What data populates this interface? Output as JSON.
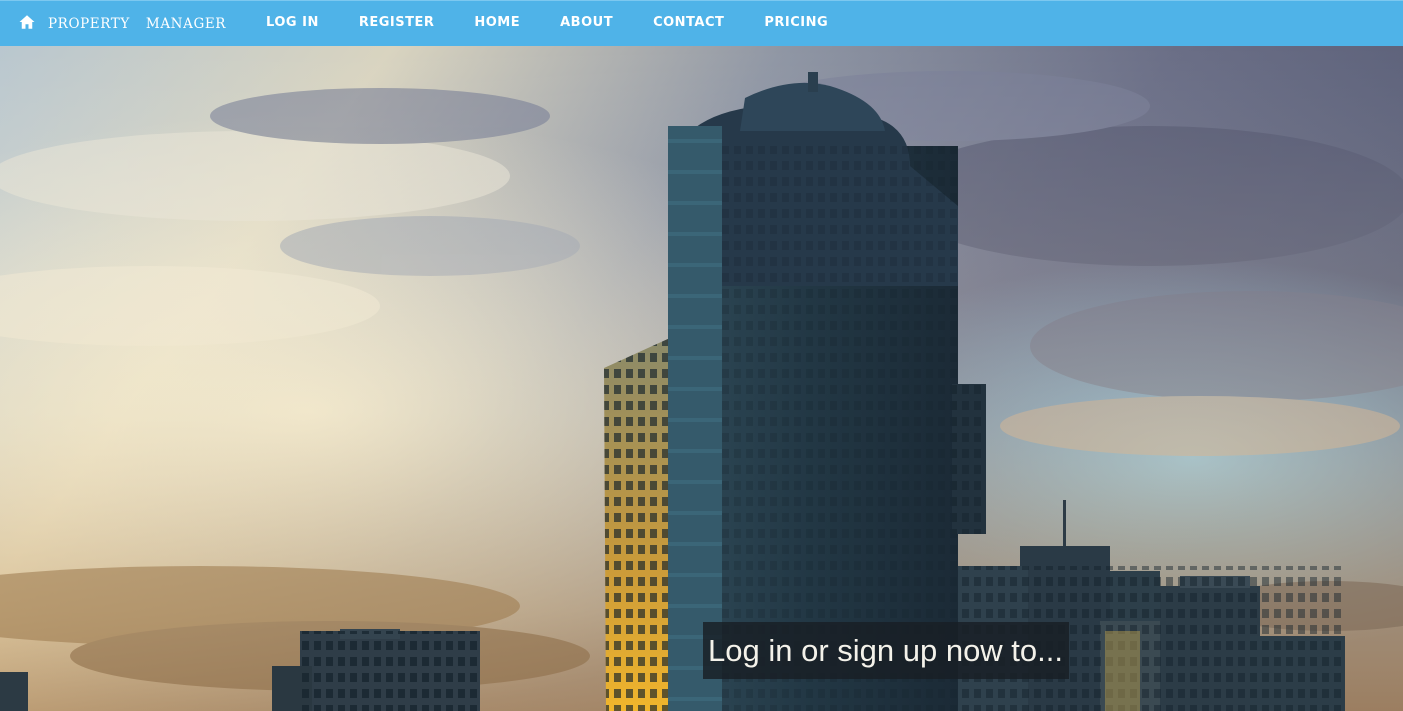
{
  "brand": {
    "icon": "home-icon",
    "word1": "PROPERTY",
    "word2": "MANAGER"
  },
  "nav": {
    "items": [
      {
        "label": "LOG IN"
      },
      {
        "label": "REGISTER"
      },
      {
        "label": "HOME"
      },
      {
        "label": "ABOUT"
      },
      {
        "label": "CONTACT"
      },
      {
        "label": "PRICING"
      }
    ]
  },
  "hero": {
    "tagline": "Log in or sign up now to..."
  },
  "colors": {
    "navbar": "#4fb3e8",
    "nav_text": "#ffffff"
  }
}
